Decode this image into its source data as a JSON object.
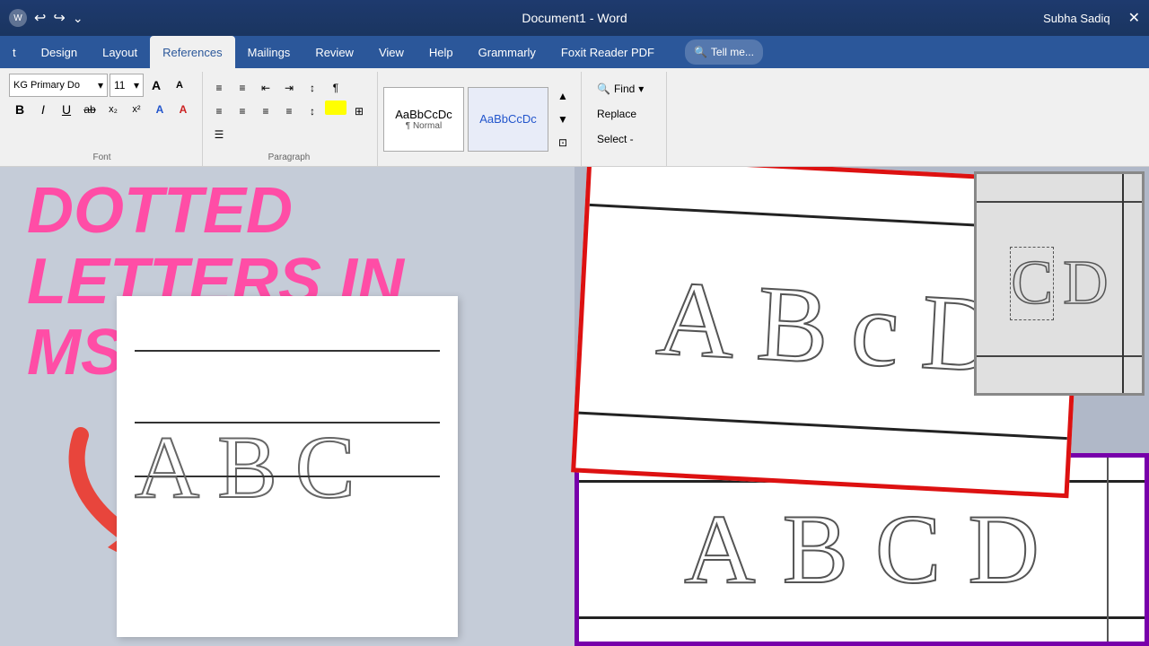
{
  "titlebar": {
    "title": "Document1 - Word",
    "user": "Subha Sadiq",
    "undo_label": "↩",
    "redo_label": "↪"
  },
  "ribbon": {
    "tabs": [
      {
        "label": "t",
        "active": false
      },
      {
        "label": "Design",
        "active": false
      },
      {
        "label": "Layout",
        "active": false
      },
      {
        "label": "References",
        "active": true
      },
      {
        "label": "Mailings",
        "active": false
      },
      {
        "label": "Review",
        "active": false
      },
      {
        "label": "View",
        "active": false
      },
      {
        "label": "Help",
        "active": false
      },
      {
        "label": "Grammarly",
        "active": false
      },
      {
        "label": "Foxit Reader PDF",
        "active": false
      }
    ],
    "font_name": "KG Primary Do",
    "font_size": "11",
    "tell_me": "Tell me...",
    "find_label": "Find",
    "replace_label": "Replace",
    "select_label": "Select -",
    "style1_label": "AaBbCcDc",
    "style1_sub": "¶ Normal",
    "style2_label": "AaBbCcDc",
    "bold": "B",
    "italic": "I",
    "underline": "U",
    "strikethrough": "ab",
    "subscript": "x₂",
    "superscript": "x²"
  },
  "overlay": {
    "line1": "DOTTED",
    "line2": "LETTERS IN",
    "line3": "MS WORD"
  },
  "doc": {
    "letters": [
      "A",
      "B",
      "C"
    ]
  },
  "thumbnails": {
    "main_letters": [
      "A",
      "B",
      "C",
      "D"
    ],
    "dark_letters": [
      "C",
      "D"
    ],
    "purple_letters": [
      "A",
      "B",
      "C",
      "D"
    ]
  }
}
